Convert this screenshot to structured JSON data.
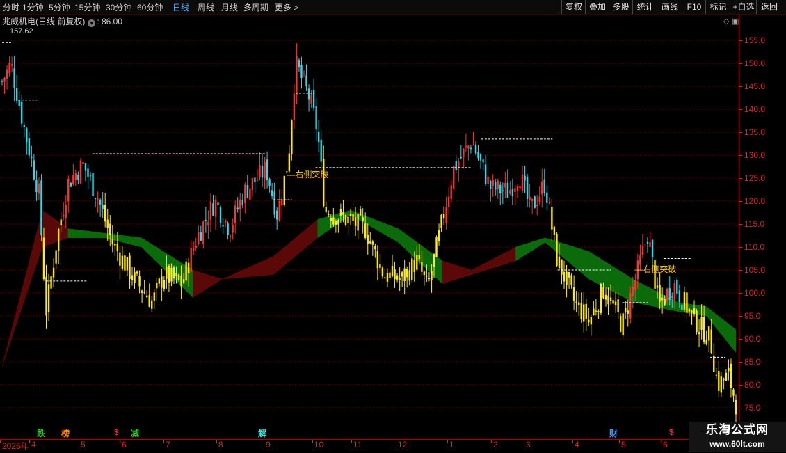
{
  "toolbar": {
    "periods": [
      "分时",
      "1分钟",
      "5分钟",
      "15分钟",
      "30分钟",
      "60分钟",
      "日线",
      "周线",
      "月线",
      "多周期",
      "更多 >"
    ],
    "right_buttons": [
      "复权",
      "叠加",
      "多股",
      "统计",
      "画线",
      "F10",
      "标记",
      "+自选",
      "返回"
    ]
  },
  "info": {
    "title": "兆威机电(日线 前复权)",
    "value_label": "86.00"
  },
  "high_label": "157.62",
  "chart_data": {
    "type": "candlestick",
    "title": "兆威机电(日线 前复权)",
    "ylim": [
      74,
      160
    ],
    "yticks": [
      "155.0",
      "150.0",
      "145.0",
      "140.0",
      "135.0",
      "130.0",
      "125.0",
      "120.0",
      "115.0",
      "110.0",
      "105.0",
      "100.0",
      "95.0",
      "90.0",
      "85.0",
      "80.0",
      "75.0"
    ],
    "xticks": [
      "2025年",
      "4",
      "5",
      "6",
      "7",
      "8",
      "9",
      "10",
      "11",
      "12",
      "1",
      "2",
      "3",
      "4",
      "5",
      "6"
    ],
    "anchors": [
      {
        "t": 0.0,
        "p": 146,
        "s": "c"
      },
      {
        "t": 0.012,
        "p": 150,
        "s": "c"
      },
      {
        "t": 0.03,
        "p": 136,
        "s": "c"
      },
      {
        "t": 0.05,
        "p": 122,
        "s": "c"
      },
      {
        "t": 0.06,
        "p": 96,
        "s": "y"
      },
      {
        "t": 0.075,
        "p": 112,
        "s": "y"
      },
      {
        "t": 0.09,
        "p": 124,
        "s": "c"
      },
      {
        "t": 0.11,
        "p": 128,
        "s": "c"
      },
      {
        "t": 0.13,
        "p": 121,
        "s": "c"
      },
      {
        "t": 0.15,
        "p": 111,
        "s": "y"
      },
      {
        "t": 0.18,
        "p": 103,
        "s": "y"
      },
      {
        "t": 0.205,
        "p": 98,
        "s": "y"
      },
      {
        "t": 0.22,
        "p": 104,
        "s": "y"
      },
      {
        "t": 0.245,
        "p": 102,
        "s": "y"
      },
      {
        "t": 0.265,
        "p": 112,
        "s": "c"
      },
      {
        "t": 0.29,
        "p": 120,
        "s": "c"
      },
      {
        "t": 0.31,
        "p": 114,
        "s": "c"
      },
      {
        "t": 0.33,
        "p": 122,
        "s": "c"
      },
      {
        "t": 0.36,
        "p": 127,
        "s": "c"
      },
      {
        "t": 0.375,
        "p": 117,
        "s": "c"
      },
      {
        "t": 0.39,
        "p": 129,
        "s": "y"
      },
      {
        "t": 0.4,
        "p": 150,
        "s": "c"
      },
      {
        "t": 0.42,
        "p": 142,
        "s": "c"
      },
      {
        "t": 0.43,
        "p": 135,
        "s": "c"
      },
      {
        "t": 0.44,
        "p": 118,
        "s": "y"
      },
      {
        "t": 0.47,
        "p": 116,
        "s": "y"
      },
      {
        "t": 0.495,
        "p": 114,
        "s": "y"
      },
      {
        "t": 0.52,
        "p": 104,
        "s": "y"
      },
      {
        "t": 0.545,
        "p": 103,
        "s": "y"
      },
      {
        "t": 0.565,
        "p": 107,
        "s": "y"
      },
      {
        "t": 0.58,
        "p": 101,
        "s": "y"
      },
      {
        "t": 0.595,
        "p": 112,
        "s": "y"
      },
      {
        "t": 0.615,
        "p": 127,
        "s": "c"
      },
      {
        "t": 0.64,
        "p": 133,
        "s": "c"
      },
      {
        "t": 0.665,
        "p": 123,
        "s": "c"
      },
      {
        "t": 0.69,
        "p": 122,
        "s": "c"
      },
      {
        "t": 0.705,
        "p": 126,
        "s": "c"
      },
      {
        "t": 0.72,
        "p": 118,
        "s": "c"
      },
      {
        "t": 0.74,
        "p": 124,
        "s": "c"
      },
      {
        "t": 0.755,
        "p": 108,
        "s": "y"
      },
      {
        "t": 0.78,
        "p": 98,
        "s": "y"
      },
      {
        "t": 0.8,
        "p": 94,
        "s": "y"
      },
      {
        "t": 0.82,
        "p": 101,
        "s": "y"
      },
      {
        "t": 0.845,
        "p": 93,
        "s": "y"
      },
      {
        "t": 0.865,
        "p": 104,
        "s": "c"
      },
      {
        "t": 0.88,
        "p": 113,
        "s": "c"
      },
      {
        "t": 0.895,
        "p": 97,
        "s": "y"
      },
      {
        "t": 0.915,
        "p": 102,
        "s": "c"
      },
      {
        "t": 0.94,
        "p": 95,
        "s": "y"
      },
      {
        "t": 0.965,
        "p": 90,
        "s": "y"
      },
      {
        "t": 0.975,
        "p": 80,
        "s": "y"
      },
      {
        "t": 0.99,
        "p": 82,
        "s": "y"
      },
      {
        "t": 1.0,
        "p": 76,
        "s": "y"
      }
    ],
    "ribbon": [
      {
        "t": 0.0,
        "a": 84,
        "b": 84,
        "c": "r"
      },
      {
        "t": 0.055,
        "a": 118,
        "b": 110,
        "c": "r"
      },
      {
        "t": 0.09,
        "a": 114,
        "b": 112,
        "c": "r"
      },
      {
        "t": 0.14,
        "a": 113,
        "b": 112,
        "c": "g"
      },
      {
        "t": 0.19,
        "a": 112,
        "b": 110,
        "c": "g"
      },
      {
        "t": 0.26,
        "a": 105,
        "b": 99,
        "c": "g"
      },
      {
        "t": 0.3,
        "a": 103,
        "b": 103,
        "c": "r"
      },
      {
        "t": 0.37,
        "a": 108,
        "b": 104,
        "c": "r"
      },
      {
        "t": 0.43,
        "a": 116,
        "b": 112,
        "c": "r"
      },
      {
        "t": 0.475,
        "a": 118,
        "b": 117,
        "c": "g"
      },
      {
        "t": 0.54,
        "a": 114,
        "b": 111,
        "c": "g"
      },
      {
        "t": 0.6,
        "a": 107,
        "b": 102,
        "c": "g"
      },
      {
        "t": 0.64,
        "a": 105,
        "b": 104,
        "c": "r"
      },
      {
        "t": 0.7,
        "a": 110,
        "b": 107,
        "c": "r"
      },
      {
        "t": 0.74,
        "a": 112,
        "b": 111,
        "c": "g"
      },
      {
        "t": 0.8,
        "a": 109,
        "b": 103,
        "c": "g"
      },
      {
        "t": 0.86,
        "a": 103,
        "b": 98,
        "c": "g"
      },
      {
        "t": 0.92,
        "a": 98,
        "b": 96,
        "c": "g"
      },
      {
        "t": 0.96,
        "a": 97,
        "b": 95,
        "c": "g"
      },
      {
        "t": 1.0,
        "a": 92,
        "b": 87,
        "c": "g"
      }
    ],
    "levels": [
      {
        "t0": 0.0,
        "t1": 0.015,
        "p": 154.5
      },
      {
        "t0": 0.022,
        "t1": 0.048,
        "p": 142
      },
      {
        "t0": 0.06,
        "t1": 0.115,
        "p": 102.6
      },
      {
        "t0": 0.123,
        "t1": 0.36,
        "p": 130.3
      },
      {
        "t0": 0.37,
        "t1": 0.395,
        "p": 120.3
      },
      {
        "t0": 0.4,
        "t1": 0.426,
        "p": 143.5
      },
      {
        "t0": 0.427,
        "t1": 0.64,
        "p": 127.3
      },
      {
        "t0": 0.653,
        "t1": 0.75,
        "p": 133.5
      },
      {
        "t0": 0.757,
        "t1": 0.83,
        "p": 105
      },
      {
        "t0": 0.845,
        "t1": 0.88,
        "p": 97.9
      },
      {
        "t0": 0.902,
        "t1": 0.94,
        "p": 107.5
      },
      {
        "t0": 0.965,
        "t1": 0.985,
        "p": 86
      }
    ],
    "annotations": [
      {
        "text": "右侧突破",
        "t": 0.388,
        "p": 126
      },
      {
        "text": "右侧突破",
        "t": 0.862,
        "p": 105.5
      }
    ],
    "events": [
      {
        "label": "跌",
        "color": "#22cc22"
      },
      {
        "label": "榜",
        "color": "#ff8800"
      },
      {
        "label": "$",
        "color": "#ff2222"
      },
      {
        "label": "减",
        "color": "#22cc22"
      },
      {
        "label": "解",
        "color": "#44dddd"
      },
      {
        "label": "财",
        "color": "#4499ff"
      },
      {
        "label": "$",
        "color": "#ff2222"
      }
    ]
  },
  "watermark": {
    "line1": "乐淘公式网",
    "line2": "www.60lt.com"
  }
}
